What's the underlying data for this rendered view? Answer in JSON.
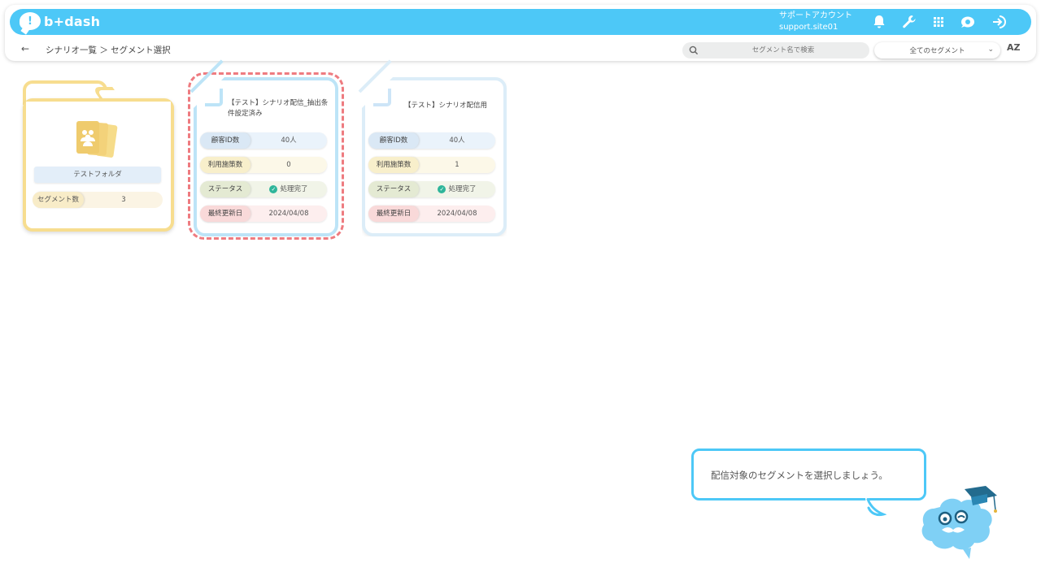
{
  "app": {
    "logo_text": "b+dash"
  },
  "header": {
    "account_label": "サポートアカウント",
    "account_id": "support.site01"
  },
  "nav": {
    "back_icon": "arrow-left-icon",
    "breadcrumb": "シナリオ一覧 ＞ セグメント選択"
  },
  "search": {
    "placeholder": "セグメント名で検索"
  },
  "filter": {
    "selected": "全てのセグメント"
  },
  "sort": {
    "label": "AZ"
  },
  "folder": {
    "name": "テストフォルダ",
    "count_label": "セグメント数",
    "count_value": "3"
  },
  "cards": [
    {
      "title": "【テスト】シナリオ配信_抽出条件設定済み",
      "customer_label": "顧客ID数",
      "customer_value": "40人",
      "usage_label": "利用施策数",
      "usage_value": "0",
      "status_label": "ステータス",
      "status_value": "処理完了",
      "updated_label": "最終更新日",
      "updated_value": "2024/04/08"
    },
    {
      "title": "【テスト】シナリオ配信用",
      "customer_label": "顧客ID数",
      "customer_value": "40人",
      "usage_label": "利用施策数",
      "usage_value": "1",
      "status_label": "ステータス",
      "status_value": "処理完了",
      "updated_label": "最終更新日",
      "updated_value": "2024/04/08"
    }
  ],
  "tooltip": {
    "text": "配信対象のセグメントを選択しましょう。"
  },
  "colors": {
    "brand": "#4dc8f7",
    "folder": "#f7dd8f",
    "selected": "#ee7b80"
  }
}
